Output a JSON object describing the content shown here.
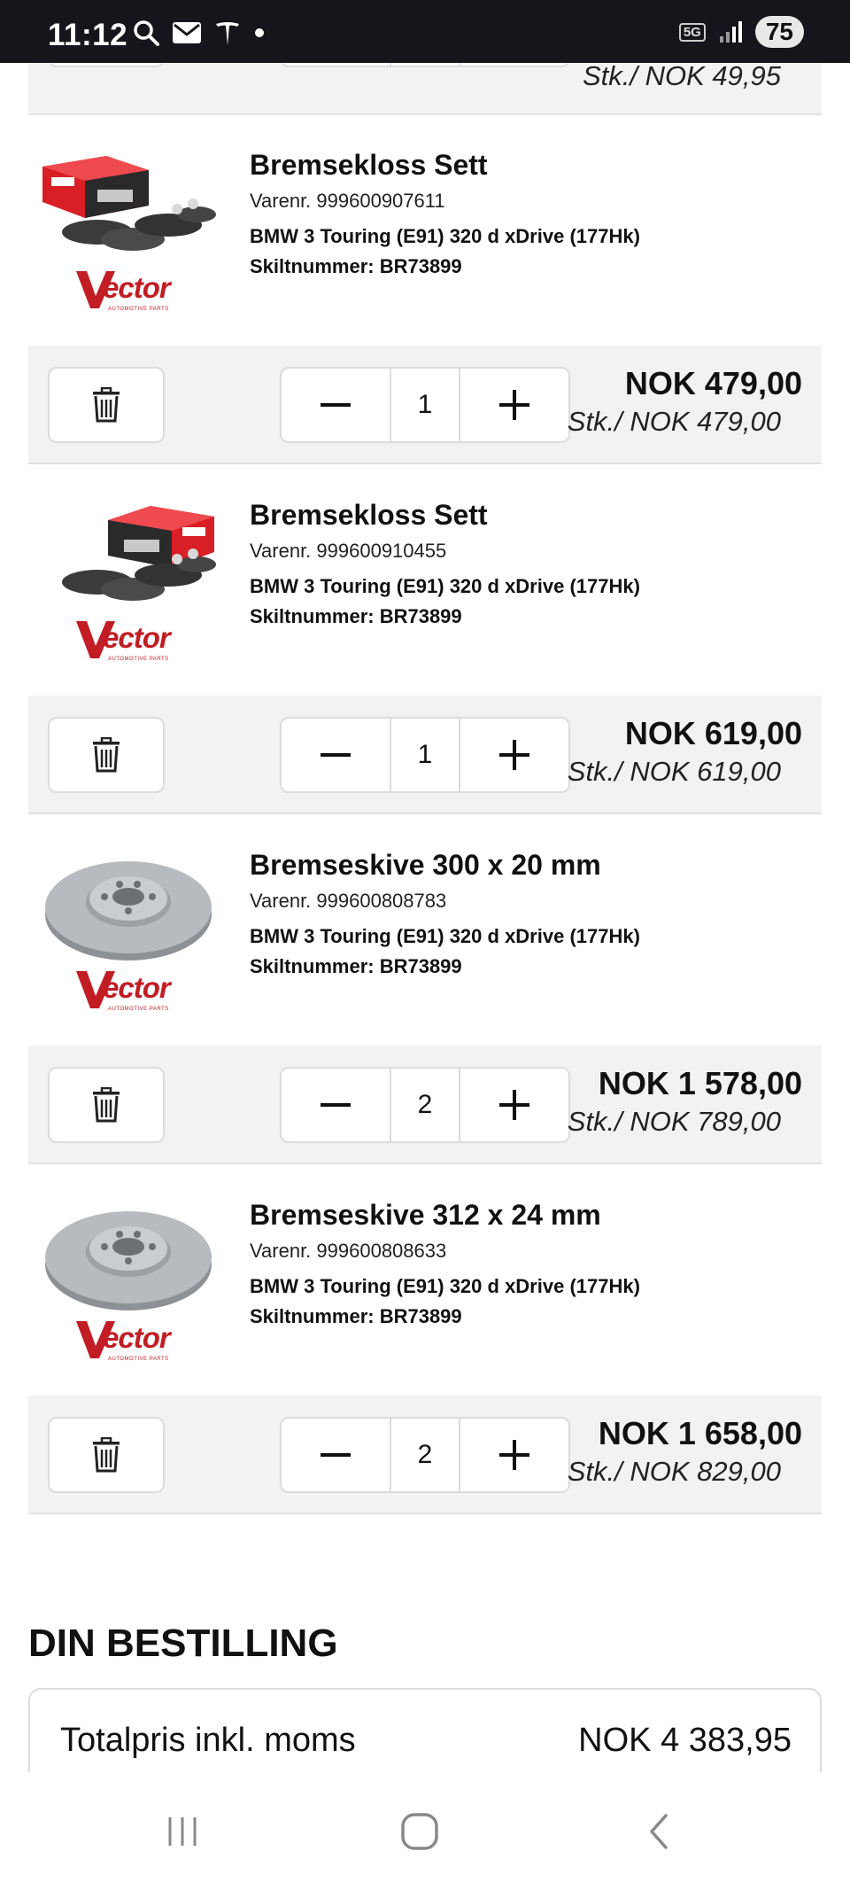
{
  "status_bar": {
    "time": "11:12",
    "network": "5G",
    "battery": "75"
  },
  "top_partial": {
    "unit_price": "Stk./ NOK 49,95"
  },
  "items": [
    {
      "name": "Bremsekloss Sett",
      "varenr": "Varenr. 999600907611",
      "car": "BMW 3 Touring (E91) 320 d xDrive (177Hk)",
      "skiltnummer": "Skiltnummer: BR73899",
      "brand": "ector",
      "brand_sub": "AUTOMOTIVE PARTS",
      "qty": "1",
      "total": "NOK 479,00",
      "unit_price": "Stk./ NOK 479,00",
      "image": "brake-pad-set"
    },
    {
      "name": "Bremsekloss Sett",
      "varenr": "Varenr. 999600910455",
      "car": "BMW 3 Touring (E91) 320 d xDrive (177Hk)",
      "skiltnummer": "Skiltnummer: BR73899",
      "brand": "ector",
      "brand_sub": "AUTOMOTIVE PARTS",
      "qty": "1",
      "total": "NOK 619,00",
      "unit_price": "Stk./ NOK 619,00",
      "image": "brake-pad-set"
    },
    {
      "name": "Bremseskive 300 x 20 mm",
      "varenr": "Varenr. 999600808783",
      "car": "BMW 3 Touring (E91) 320 d xDrive (177Hk)",
      "skiltnummer": "Skiltnummer: BR73899",
      "brand": "ector",
      "brand_sub": "AUTOMOTIVE PARTS",
      "qty": "2",
      "total": "NOK 1 578,00",
      "unit_price": "Stk./ NOK 789,00",
      "image": "brake-disc"
    },
    {
      "name": "Bremseskive 312 x 24 mm",
      "varenr": "Varenr. 999600808633",
      "car": "BMW 3 Touring (E91) 320 d xDrive (177Hk)",
      "skiltnummer": "Skiltnummer: BR73899",
      "brand": "ector",
      "brand_sub": "AUTOMOTIVE PARTS",
      "qty": "2",
      "total": "NOK 1 658,00",
      "unit_price": "Stk./ NOK 829,00",
      "image": "brake-disc"
    }
  ],
  "summary": {
    "title": "DIN BESTILLING",
    "total_label": "Totalpris inkl. moms",
    "total_value": "NOK 4 383,95"
  },
  "colors": {
    "brand_red": "#c21d24",
    "bar_bg": "#f2f2f2",
    "status_bar_bg": "#15161b"
  }
}
